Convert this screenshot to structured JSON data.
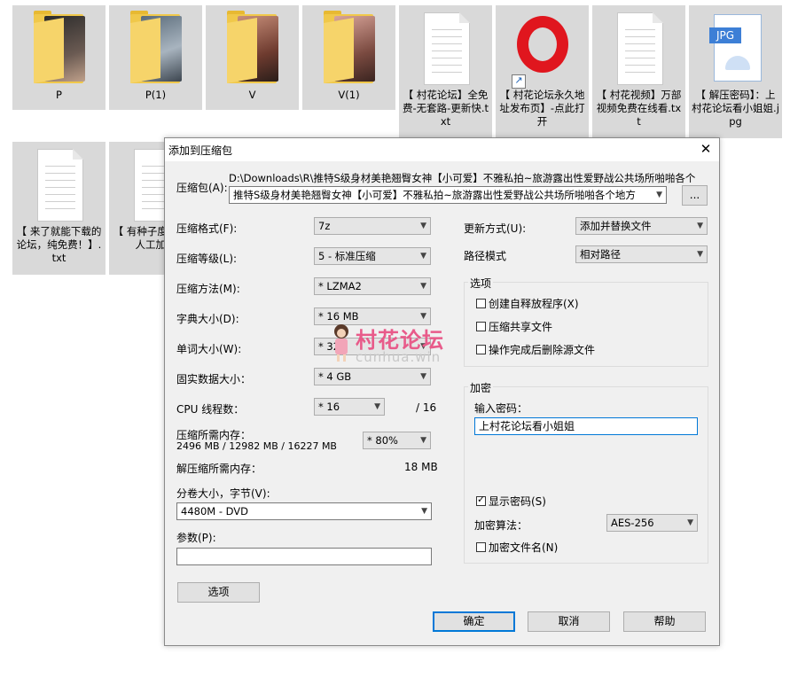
{
  "explorer": {
    "tiles": [
      {
        "kind": "folder",
        "caption": "P",
        "photo": "#3a3a3a"
      },
      {
        "kind": "folder",
        "caption": "P(1)",
        "photo": "#6b7a8a"
      },
      {
        "kind": "folder",
        "caption": "V",
        "photo": "#7b4a3a"
      },
      {
        "kind": "folder",
        "caption": "V(1)",
        "photo": "#8a5a50"
      },
      {
        "kind": "txt",
        "caption": "【 村花论坛】全免费-无套路-更新快.txt"
      },
      {
        "kind": "opera",
        "caption": "【 村花论坛永久地址发布页】-点此打开"
      },
      {
        "kind": "txt",
        "caption": "【 村花视频】万部视频免费在线看.txt"
      },
      {
        "kind": "jpg",
        "caption": "【 解压密码】：上村花论坛看小姐姐.jpg",
        "badge": "JPG"
      },
      {
        "kind": "txt",
        "caption": "【 来了就能下载的论坛，纯免费！】.txt"
      },
      {
        "kind": "txt",
        "caption": "【 有种子度？来村人工加速"
      }
    ]
  },
  "dialog": {
    "title": "添加到压缩包",
    "close": "✕",
    "archive_label": "压缩包(A):",
    "archive_path": "D:\\Downloads\\R\\推特S级身材美艳翘臀女神【小可爱】不雅私拍~旅游露出性爱野战公共场所啪啪各个",
    "archive_name": "推特S级身材美艳翘臀女神【小可爱】不雅私拍~旅游露出性爱野战公共场所啪啪各个地方",
    "browse": "...",
    "format_label": "压缩格式(F):",
    "format_value": "7z",
    "level_label": "压缩等级(L):",
    "level_value": "5 - 标准压缩",
    "method_label": "压缩方法(M):",
    "method_value": "* LZMA2",
    "dict_label": "字典大小(D):",
    "dict_value": "* 16 MB",
    "word_label": "单词大小(W):",
    "word_value": "* 32",
    "solid_label": "固实数据大小：",
    "solid_value": "* 4 GB",
    "cpu_label": "CPU 线程数：",
    "cpu_value": "* 16",
    "cpu_total": "/ 16",
    "mem_label": "压缩所需内存：",
    "mem_detail": "2496 MB / 12982 MB / 16227 MB",
    "mem_percent": "* 80%",
    "decomp_label": "解压缩所需内存：",
    "decomp_value": "18 MB",
    "volume_label": "分卷大小，字节(V):",
    "volume_value": "4480M - DVD",
    "params_label": "参数(P):",
    "params_value": "",
    "options_button": "选项",
    "update_label": "更新方式(U):",
    "update_value": "添加并替换文件",
    "path_label": "路径模式",
    "path_value": "相对路径",
    "options_group": "选项",
    "opt_sfx": "创建自释放程序(X)",
    "opt_shared": "压缩共享文件",
    "opt_delete": "操作完成后删除源文件",
    "encrypt_group": "加密",
    "password_label": "输入密码：",
    "password_value": "上村花论坛看小姐姐",
    "show_password": "显示密码(S)",
    "algo_label": "加密算法：",
    "algo_value": "AES-256",
    "encrypt_names": "加密文件名(N)",
    "ok": "确定",
    "cancel": "取消",
    "help": "帮助"
  },
  "watermark": {
    "title": "村花论坛",
    "url": "cunhua.win"
  },
  "colors": {
    "accent": "#0078d7",
    "tile_bg": "#d9d9d9",
    "dialog_bg": "#f0f0f0",
    "watermark": "#e85b8a"
  }
}
